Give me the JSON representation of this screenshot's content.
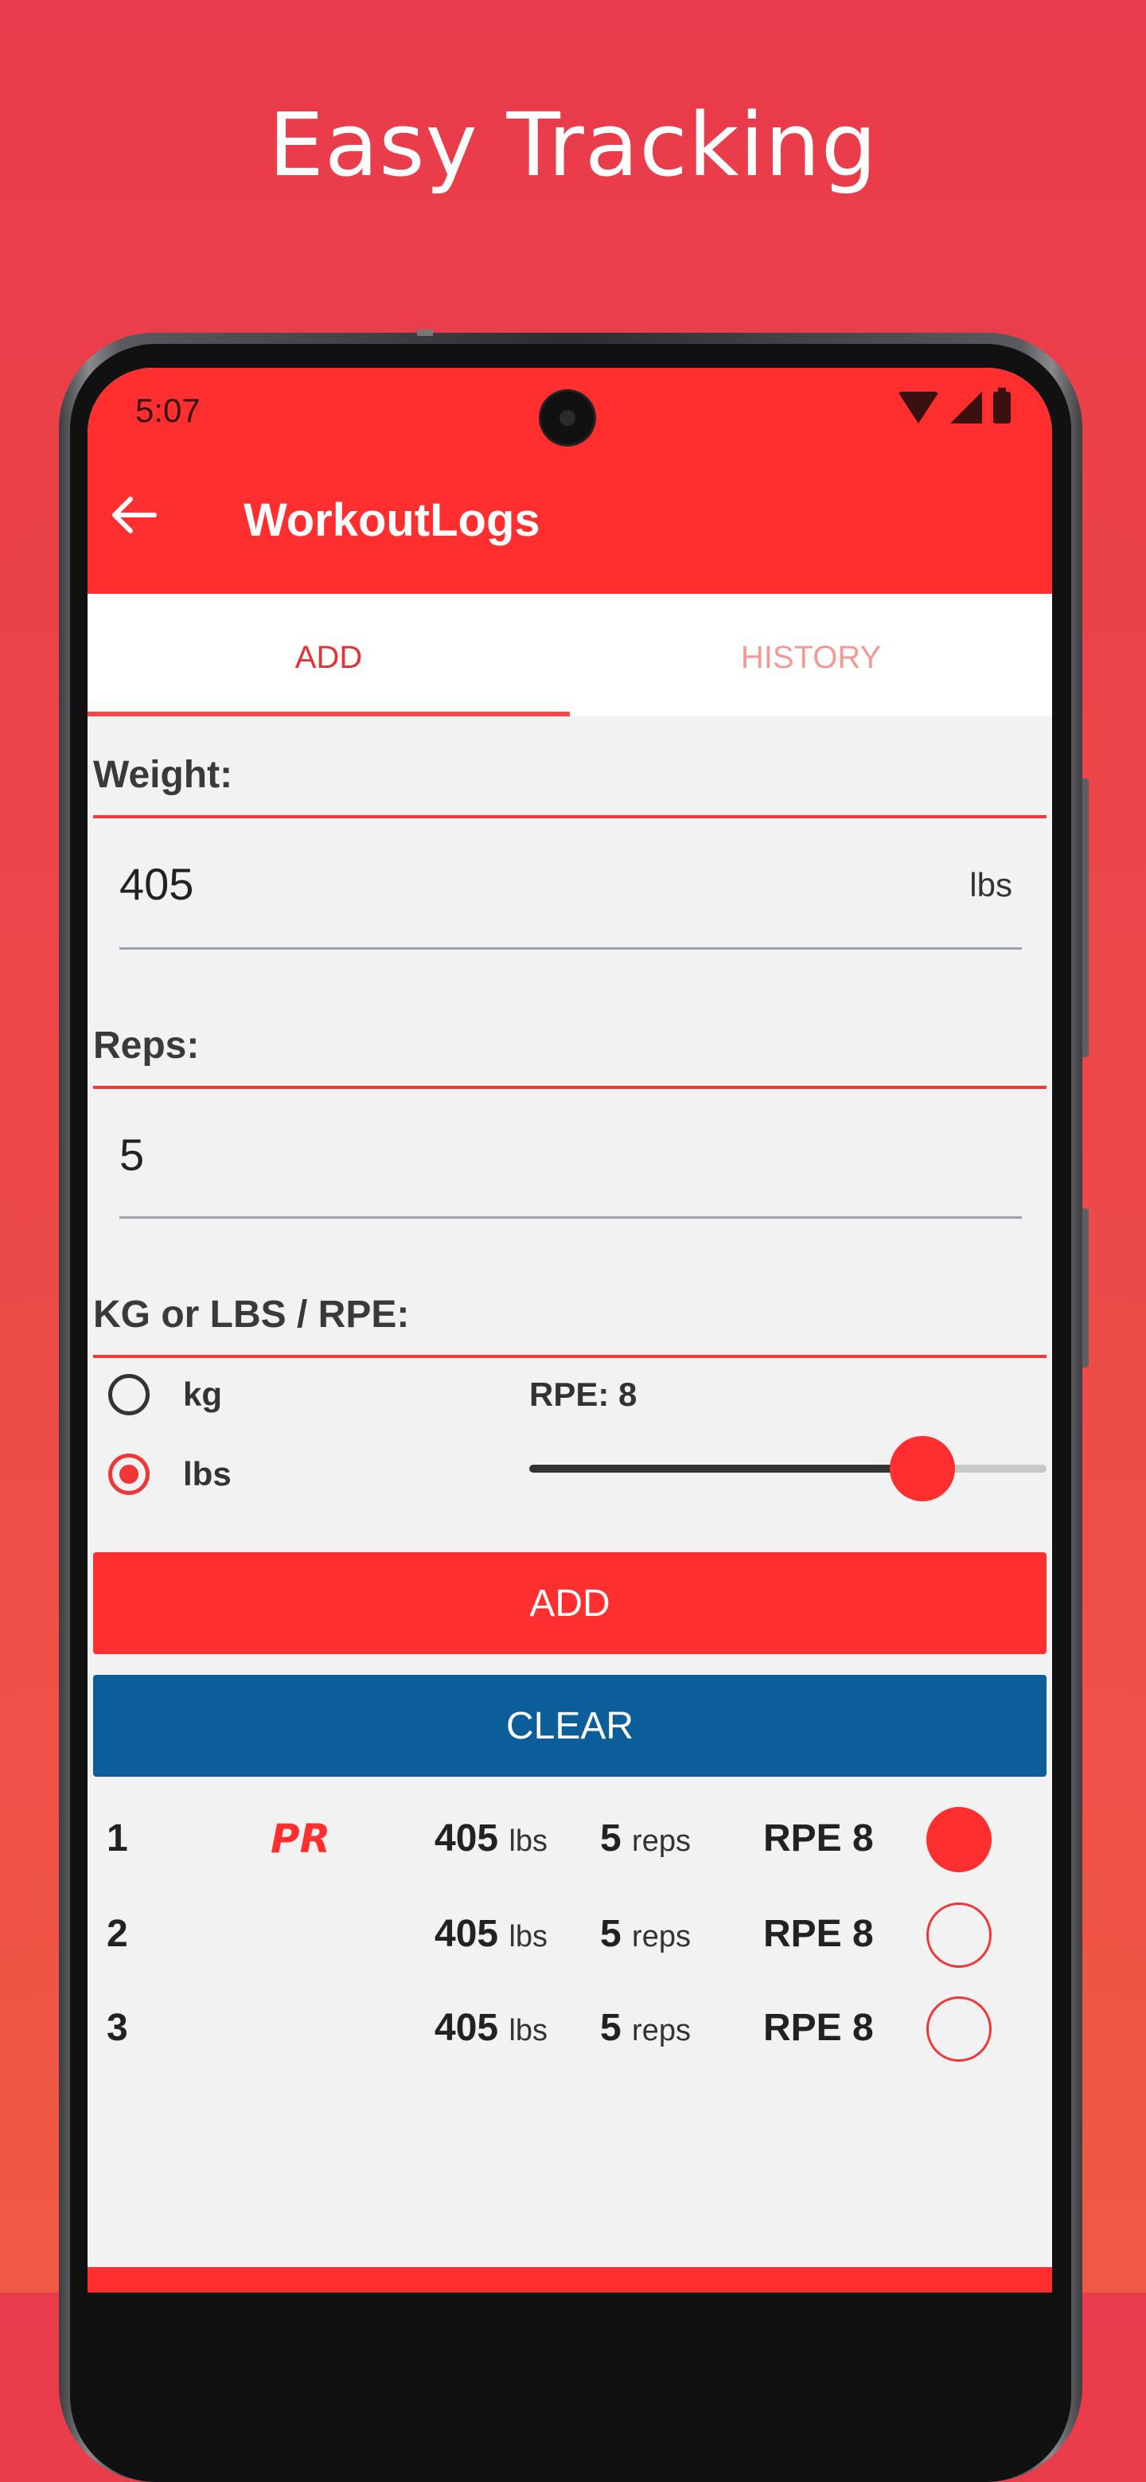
{
  "promo": {
    "title": "Easy Tracking"
  },
  "status_bar": {
    "time": "5:07"
  },
  "app": {
    "title": "WorkoutLogs",
    "tabs": [
      {
        "label": "ADD",
        "active": true
      },
      {
        "label": "HISTORY",
        "active": false
      }
    ]
  },
  "form": {
    "weight": {
      "label": "Weight:",
      "value": "405",
      "unit": "lbs"
    },
    "reps": {
      "label": "Reps:",
      "value": "5"
    },
    "unit_rpe": {
      "label": "KG or LBS / RPE:",
      "options": [
        {
          "label": "kg",
          "selected": false
        },
        {
          "label": "lbs",
          "selected": true
        }
      ],
      "rpe_label": "RPE: 8",
      "rpe_fraction": 0.76
    }
  },
  "buttons": {
    "add": "ADD",
    "clear": "CLEAR"
  },
  "sets": [
    {
      "num": "1",
      "pr": "PR",
      "weight": "405",
      "weight_unit": "lbs",
      "reps": "5",
      "reps_unit": "reps",
      "rpe": "RPE 8",
      "completed": true
    },
    {
      "num": "2",
      "pr": "",
      "weight": "405",
      "weight_unit": "lbs",
      "reps": "5",
      "reps_unit": "reps",
      "rpe": "RPE 8",
      "completed": false
    },
    {
      "num": "3",
      "pr": "",
      "weight": "405",
      "weight_unit": "lbs",
      "reps": "5",
      "reps_unit": "reps",
      "rpe": "RPE 8",
      "completed": false
    }
  ],
  "colors": {
    "primary": "#ff2f2f",
    "clear_button": "#0b5e9a",
    "background": "#f2f2f2"
  }
}
